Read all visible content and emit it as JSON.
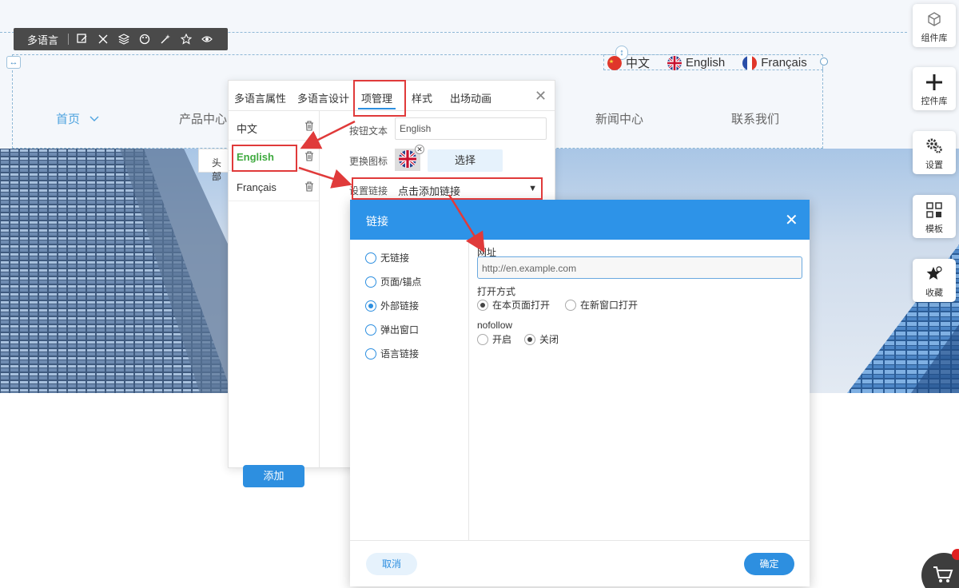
{
  "toolbar": {
    "label": "多语言"
  },
  "languages": [
    {
      "label": "中文",
      "flag": "cn-flag"
    },
    {
      "label": "English",
      "flag": "uk-flag"
    },
    {
      "label": "Français",
      "flag": "fr-flag"
    }
  ],
  "nav_menu": {
    "items": [
      "首页",
      "产品中心",
      "新闻中心",
      "联系我们"
    ],
    "active": "首页"
  },
  "hero": {
    "chip_label": "头部"
  },
  "panel": {
    "tabs": [
      "多语言属性",
      "多语言设计",
      "项管理",
      "样式",
      "出场动画"
    ],
    "active_tab": "项管理",
    "items": [
      {
        "label": "中文"
      },
      {
        "label": "English",
        "selected": true
      },
      {
        "label": "Français"
      }
    ],
    "add_label": "添加",
    "fields": {
      "button_text_label": "按钮文本",
      "button_text_value": "English",
      "icon_label": "更换图标",
      "choose_label": "选择",
      "link_label": "设置链接",
      "link_value": "点击添加链接"
    }
  },
  "dialog": {
    "title": "链接",
    "link_types": [
      {
        "label": "无链接",
        "checked": false
      },
      {
        "label": "页面/锚点",
        "checked": false
      },
      {
        "label": "外部链接",
        "checked": true
      },
      {
        "label": "弹出窗口",
        "checked": false
      },
      {
        "label": "语言链接",
        "checked": false
      }
    ],
    "url_label": "网址",
    "url_placeholder": "http://en.example.com",
    "open_mode_label": "打开方式",
    "open_modes": [
      {
        "label": "在本页面打开",
        "checked": true
      },
      {
        "label": "在新窗口打开",
        "checked": false
      }
    ],
    "nofollow_label": "nofollow",
    "nofollow_options": [
      {
        "label": "开启",
        "checked": false
      },
      {
        "label": "关闭",
        "checked": true
      }
    ],
    "cancel_label": "取消",
    "ok_label": "确定"
  },
  "dock": [
    {
      "label": "组件库",
      "icon": "cube-icon"
    },
    {
      "label": "控件库",
      "icon": "plus-icon"
    },
    {
      "label": "设置",
      "icon": "gears-icon"
    },
    {
      "label": "模板",
      "icon": "grid-icon"
    },
    {
      "label": "收藏",
      "icon": "star-icon"
    }
  ],
  "colors": {
    "accent": "#2d8fe0",
    "annotation": "#e03a3a",
    "selected_item": "#3faa3f",
    "toolbar": "#4a4a4a"
  }
}
